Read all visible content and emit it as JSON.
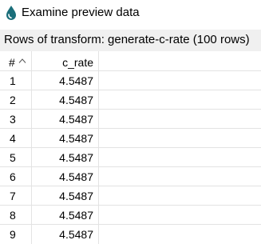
{
  "window": {
    "title": "Examine preview data",
    "icon": "hop-droplet-icon"
  },
  "caption": "Rows of transform: generate-c-rate (100 rows)",
  "table": {
    "columns": [
      "#",
      "c_rate"
    ],
    "sort_indicator": "sort-ascending-icon",
    "rows": [
      {
        "num": "1",
        "value": "4.5487"
      },
      {
        "num": "2",
        "value": "4.5487"
      },
      {
        "num": "3",
        "value": "4.5487"
      },
      {
        "num": "4",
        "value": "4.5487"
      },
      {
        "num": "5",
        "value": "4.5487"
      },
      {
        "num": "6",
        "value": "4.5487"
      },
      {
        "num": "7",
        "value": "4.5487"
      },
      {
        "num": "8",
        "value": "4.5487"
      },
      {
        "num": "9",
        "value": "4.5487"
      }
    ]
  },
  "colors": {
    "caption_bg": "#f0f0f0",
    "grid": "#e3e3e3",
    "icon_fill": "#1a6e7a"
  }
}
